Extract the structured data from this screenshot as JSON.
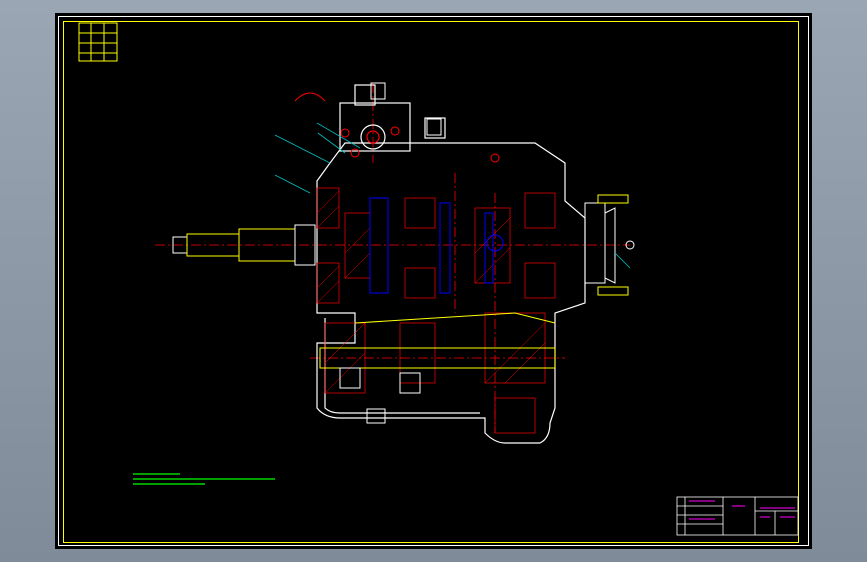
{
  "drawing": {
    "subject": "gearbox-cross-section",
    "colors": {
      "background": "#000000",
      "border": "#ffff00",
      "outline": "#ffffff",
      "centerline": "#ff0000",
      "hatch": "#ff0000",
      "shaft": "#ffff00",
      "bolt": "#ffffff",
      "leader": "#00c0c0",
      "notes": "#00ff00",
      "title_block": "#ff00ff",
      "gear_detail": "#0000ff"
    }
  }
}
